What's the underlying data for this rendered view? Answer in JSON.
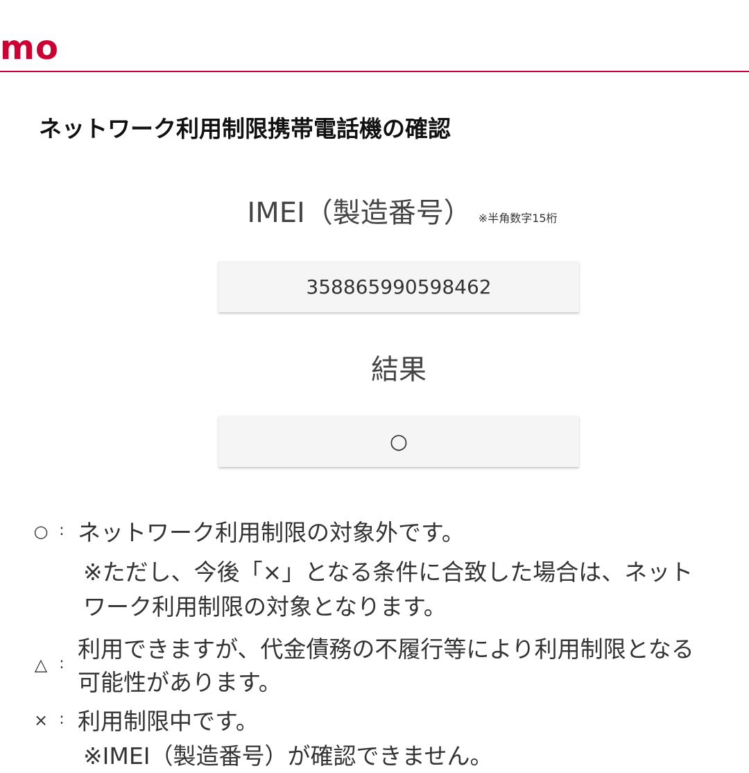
{
  "header": {
    "logo_text": "mo",
    "brand_color": "#cc0033"
  },
  "page": {
    "title": "ネットワーク利用制限携帯電話機の確認"
  },
  "imei": {
    "label": "IMEI（製造番号）",
    "note": "※半角数字15桁",
    "value": "358865990598462"
  },
  "result": {
    "label": "結果",
    "value": "○"
  },
  "legend": {
    "ok": {
      "symbol": "○",
      "colon": ":",
      "text": "ネットワーク利用制限の対象外です。",
      "note_line1": "※ただし、今後「×」となる条件に合致した場合は、ネット",
      "note_line2": "ワーク利用制限の対象となります。"
    },
    "triangle": {
      "symbol": "△",
      "colon": ":",
      "line1": "利用できますが、代金債務の不履行等により利用制限となる",
      "line2": "可能性があります。"
    },
    "cross": {
      "symbol": "×",
      "colon": ":",
      "text": "利用制限中です。"
    },
    "cut_text": "※IMEI（製造番号）が確認できません。"
  }
}
